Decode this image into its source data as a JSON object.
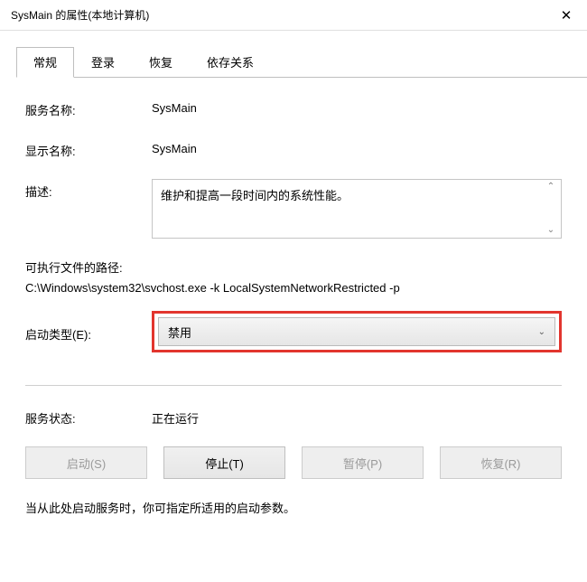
{
  "window": {
    "title": "SysMain 的属性(本地计算机)"
  },
  "tabs": {
    "general": "常规",
    "logon": "登录",
    "recovery": "恢复",
    "dependencies": "依存关系"
  },
  "labels": {
    "service_name": "服务名称:",
    "display_name": "显示名称:",
    "description": "描述:",
    "exe_path": "可执行文件的路径:",
    "startup_type": "启动类型(E):",
    "service_status": "服务状态:"
  },
  "values": {
    "service_name": "SysMain",
    "display_name": "SysMain",
    "description": "维护和提高一段时间内的系统性能。",
    "exe_path": "C:\\Windows\\system32\\svchost.exe -k LocalSystemNetworkRestricted -p",
    "startup_type": "禁用",
    "service_status": "正在运行"
  },
  "buttons": {
    "start": "启动(S)",
    "stop": "停止(T)",
    "pause": "暂停(P)",
    "resume": "恢复(R)"
  },
  "hint": "当从此处启动服务时，你可指定所适用的启动参数。"
}
